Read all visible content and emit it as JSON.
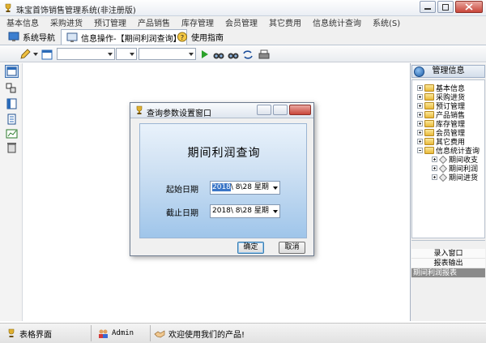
{
  "window": {
    "title": "珠宝首饰销售管理系统(非注册版)"
  },
  "menu": [
    "基本信息",
    "采购进货",
    "预订管理",
    "产品销售",
    "库存管理",
    "会员管理",
    "其它费用",
    "信息统计查询",
    "系统(S)"
  ],
  "tabs": [
    {
      "label": "系统导航",
      "icon": "monitor-icon"
    },
    {
      "label": "信息操作-【期间利润查询】",
      "icon": "monitor-icon"
    },
    {
      "label": "使用指南",
      "icon": "help-icon"
    }
  ],
  "toolbar": {
    "combo1_value": "",
    "combo2_value": "",
    "combo3_value": ""
  },
  "right_panel": {
    "header": "管理信息",
    "tree": [
      {
        "label": "基本信息",
        "level": 0,
        "expanded": false
      },
      {
        "label": "采购进货",
        "level": 0,
        "expanded": false
      },
      {
        "label": "预订管理",
        "level": 0,
        "expanded": false
      },
      {
        "label": "产品销售",
        "level": 0,
        "expanded": false
      },
      {
        "label": "库存管理",
        "level": 0,
        "expanded": false
      },
      {
        "label": "会员管理",
        "level": 0,
        "expanded": false
      },
      {
        "label": "其它费用",
        "level": 0,
        "expanded": false
      },
      {
        "label": "信息统计查询",
        "level": 0,
        "expanded": true
      },
      {
        "label": "期间收支",
        "level": 1
      },
      {
        "label": "期间利润",
        "level": 1
      },
      {
        "label": "期间进货",
        "level": 1
      }
    ],
    "actions": [
      "录入窗口",
      "报表输出"
    ],
    "selected_report": "期间利润报表"
  },
  "status": {
    "form_label": "表格界面",
    "user": "Admin",
    "message": "欢迎使用我们的产品!"
  },
  "dialog": {
    "title": "查询参数设置窗口",
    "heading": "期间利润查询",
    "start_label": "起始日期",
    "start_year": "2018",
    "start_rest": "\\ 8\\28 星期",
    "end_label": "截止日期",
    "end_value": "2018\\ 8\\28 星期",
    "ok": "确定",
    "cancel": "取消"
  }
}
